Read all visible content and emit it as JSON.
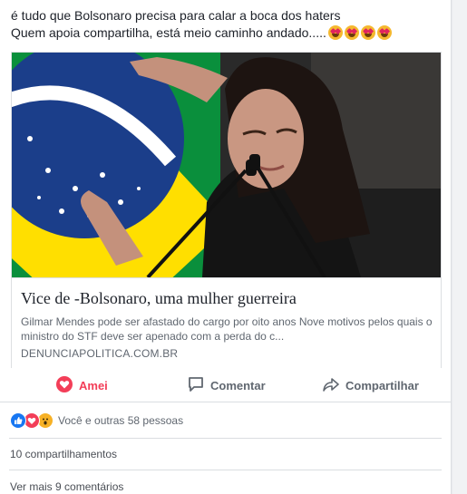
{
  "post": {
    "line1": "é tudo que Bolsonaro precisa para calar a boca dos haters",
    "line2": "Quem apoia compartilha, está meio caminho andado.....",
    "emoji": "heart-eyes-emoji"
  },
  "link_preview": {
    "title": "Vice de -Bolsonaro, uma mulher guerreira",
    "description": "Gilmar Mendes pode ser afastado do cargo por oito anos Nove motivos pelos quais o ministro do STF deve ser apenado com a perda do c...",
    "domain": "DENUNCIAPOLITICA.COM.BR"
  },
  "actions": {
    "like_label": "Amei",
    "comment_label": "Comentar",
    "share_label": "Compartilhar"
  },
  "reactions": {
    "summary": "Você e outras 58 pessoas",
    "types": [
      "like-icon",
      "love-icon",
      "wow-icon"
    ]
  },
  "shares": {
    "label": "10 compartilhamentos"
  },
  "comments": {
    "more_label": "Ver mais 9 comentários"
  },
  "colors": {
    "love": "#f33e58",
    "like": "#1877f2",
    "wow": "#f7b125",
    "flag_green": "#009c3b",
    "flag_yellow": "#ffdf00",
    "flag_blue": "#002776"
  }
}
